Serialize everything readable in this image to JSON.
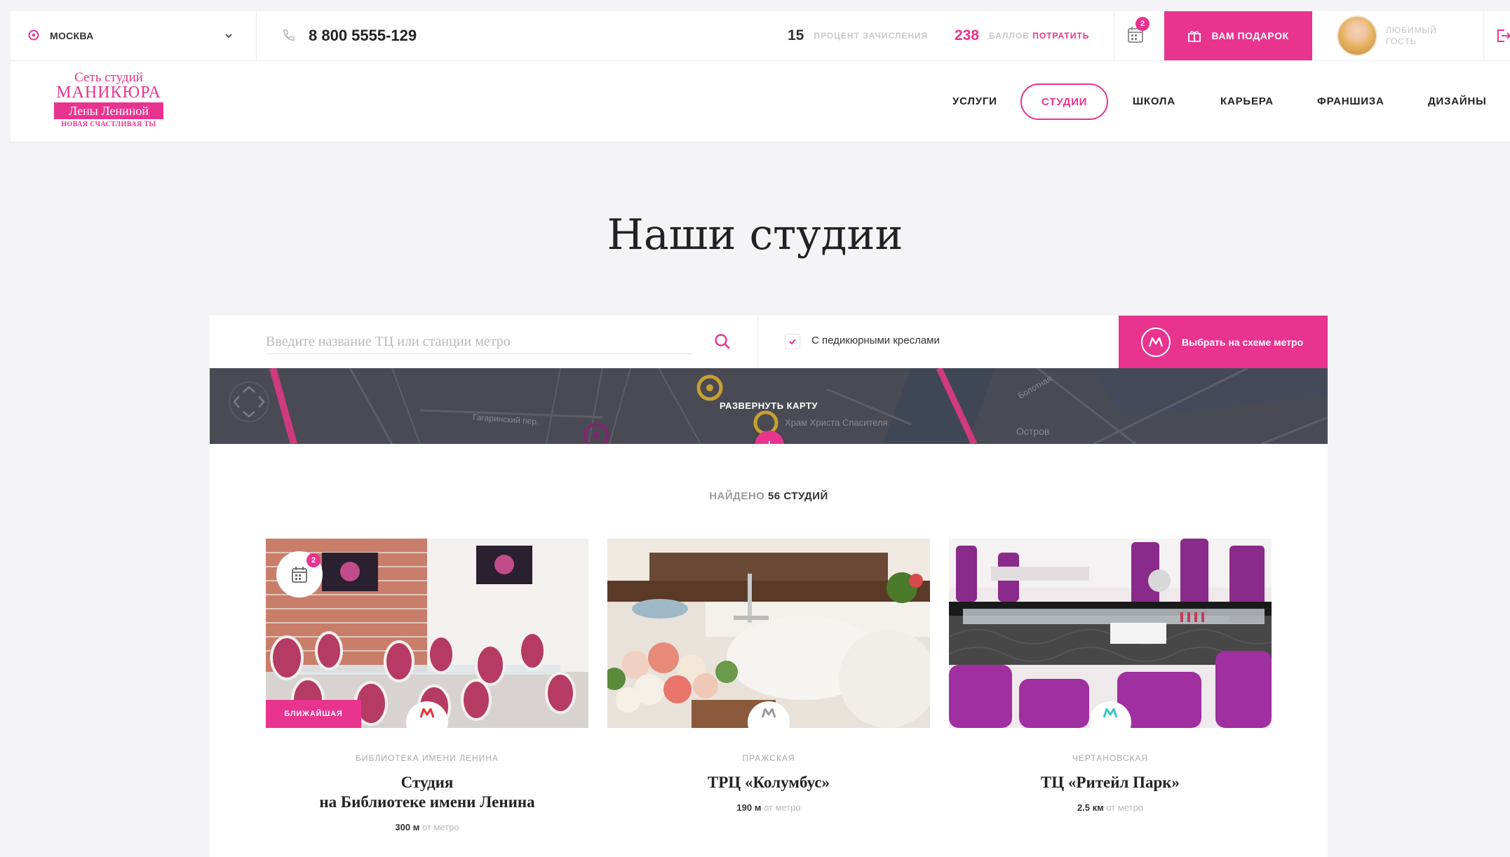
{
  "topbar": {
    "city": "МОСКВА",
    "phone": "8 800 5555-129",
    "percent_value": "15",
    "percent_label": "ПРОЦЕНТ ЗАЧИСЛЕНИЯ",
    "points_value": "238",
    "points_label": "БАЛЛОВ",
    "points_link": "ПОТРАТИТЬ",
    "cart_count": "2",
    "gift_button": "ВАМ ПОДАРОК",
    "user_line1": "ЛЮБИМЫЙ",
    "user_line2": "ГОСТЬ"
  },
  "logo": {
    "line1": "Сеть студий",
    "line2": "МАНИКЮРА",
    "line3": "Лены Лениной",
    "line4": "НОВАЯ СЧАСТЛИВАЯ ТЫ"
  },
  "nav": [
    "УСЛУГИ",
    "СТУДИИ",
    "ШКОЛА",
    "КАРЬЕРА",
    "ФРАНШИЗА",
    "ДИЗАЙНЫ"
  ],
  "page_title": "Наши студии",
  "search": {
    "placeholder": "Введите название ТЦ или станции метро",
    "checkbox_label": "С педикюрными креслами",
    "metro_button": "Выбрать на схеме метро"
  },
  "map": {
    "expand_label": "РАЗВЕРНУТЬ КАРТУ",
    "streets": [
      "Гагаринский пер.",
      "Храм Христа Спасителя",
      "Остров",
      "Болотная"
    ]
  },
  "found": {
    "prefix": "НАЙДЕНО",
    "count": "56 СТУДИЙ"
  },
  "cards": [
    {
      "metro": "БИБЛИОТЕКА ИМЕНИ ЛЕНИНА",
      "name": "Студия\nна Библиотеке имени Ленина",
      "distance": "300 м",
      "distance_suffix": "от метро",
      "badge": "БЛИЖАЙШАЯ",
      "cart_count": "2",
      "metro_color": "#e8312f"
    },
    {
      "metro": "ПРАЖСКАЯ",
      "name": "ТРЦ «Колумбус»",
      "distance": "190 м",
      "distance_suffix": "от метро",
      "metro_color": "#9a9aa0"
    },
    {
      "metro": "ЧЕРТАНОВСКАЯ",
      "name": "ТЦ «Ритейл Парк»",
      "distance": "2.5 км",
      "distance_suffix": "от метро",
      "metro_color": "#3cc6c0"
    }
  ],
  "colors": {
    "accent": "#e8348f"
  }
}
